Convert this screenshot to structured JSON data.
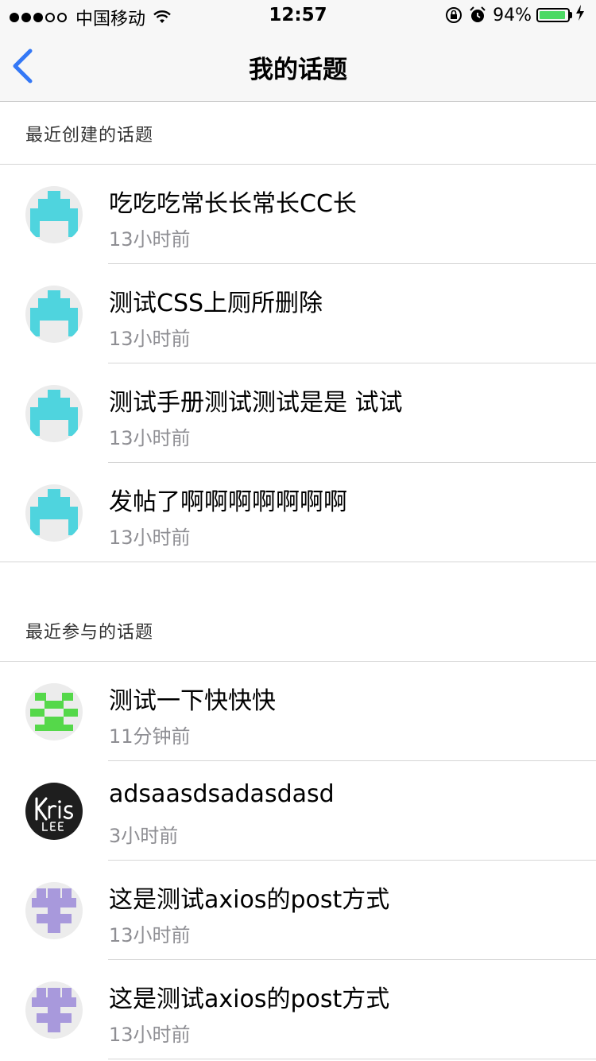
{
  "status_bar": {
    "carrier": "中国移动",
    "time": "12:57",
    "battery": "94%",
    "battery_level": 0.94
  },
  "nav": {
    "title": "我的话题",
    "back_icon": "chevron-left-icon",
    "accent": "#3478f6"
  },
  "created": {
    "header": "最近创建的话题",
    "items": [
      {
        "title": "吃吃吃常长长常长CC长",
        "time": "13小时前",
        "avatar": "cyan"
      },
      {
        "title": "测试CSS上厕所删除",
        "time": "13小时前",
        "avatar": "cyan"
      },
      {
        "title": "测试手册测试测试是是 试试",
        "time": "13小时前",
        "avatar": "cyan"
      },
      {
        "title": "发帖了啊啊啊啊啊啊啊",
        "time": "13小时前",
        "avatar": "cyan"
      }
    ]
  },
  "joined": {
    "header": "最近参与的话题",
    "items": [
      {
        "title": "测试一下快快快",
        "time": "11分钟前",
        "avatar": "green"
      },
      {
        "title": "adsaasdsadasdasd",
        "time": "3小时前",
        "avatar": "krislee"
      },
      {
        "title": "这是测试axios的post方式",
        "time": "13小时前",
        "avatar": "purple"
      },
      {
        "title": "这是测试axios的post方式",
        "time": "13小时前",
        "avatar": "purple"
      }
    ]
  },
  "colors": {
    "avatar_cyan": "#4fd4de",
    "avatar_green": "#55d84a",
    "avatar_purple": "#a899dc"
  }
}
